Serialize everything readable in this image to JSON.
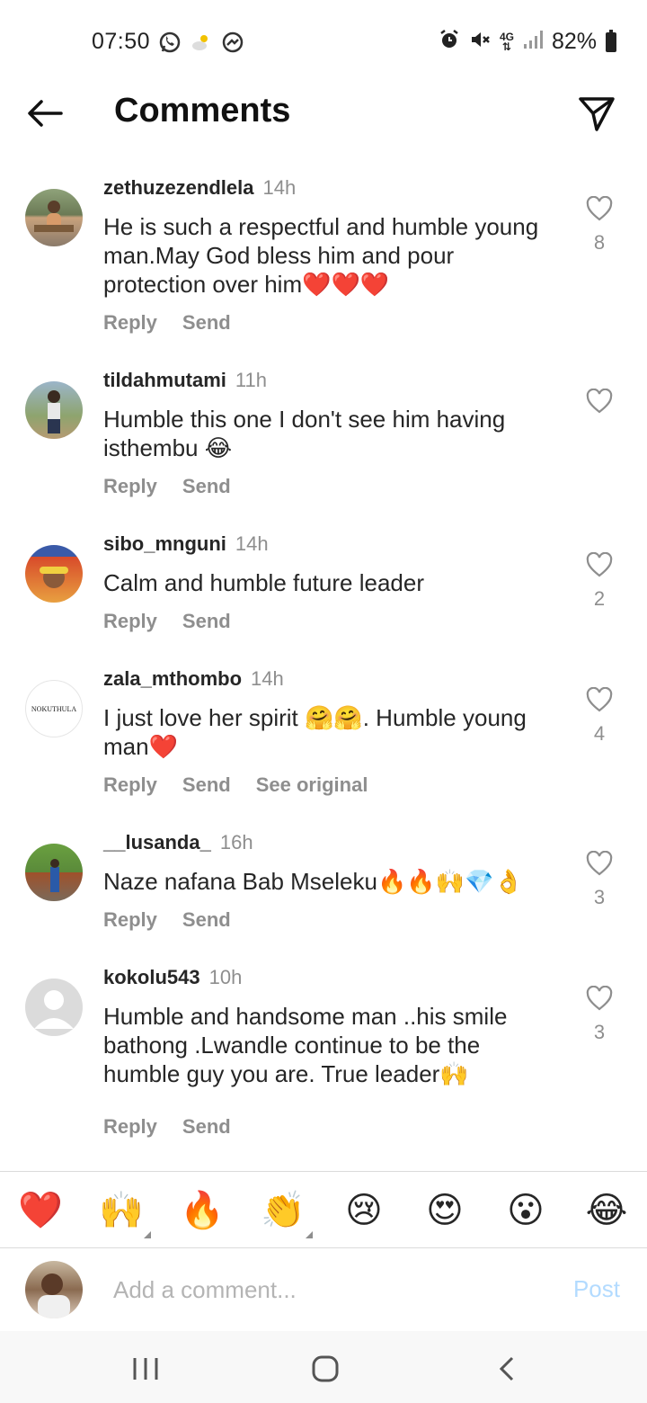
{
  "status_bar": {
    "time": "07:50",
    "battery": "82%",
    "network": "4G",
    "left_icons": [
      "whatsapp-icon",
      "weather-icon",
      "messenger-icon"
    ],
    "right_icons": [
      "alarm-icon",
      "mute-icon",
      "network-4g-icon",
      "signal-icon",
      "battery-icon"
    ]
  },
  "header": {
    "title": "Comments"
  },
  "comments": [
    {
      "username": "zethuzezendlela",
      "time": "14h",
      "text": "He is such a respectful and humble young man.May God bless him and pour protection over him❤️❤️❤️",
      "likes": "8",
      "actions": [
        "Reply",
        "Send"
      ]
    },
    {
      "username": "tildahmutami",
      "time": "11h",
      "text": "Humble this one I don't see him having isthembu 😂",
      "likes": "",
      "actions": [
        "Reply",
        "Send"
      ]
    },
    {
      "username": "sibo_mnguni",
      "time": "14h",
      "text": "Calm and humble future leader",
      "likes": "2",
      "actions": [
        "Reply",
        "Send"
      ]
    },
    {
      "username": "zala_mthombo",
      "time": "14h",
      "text": "I just love her spirit 🤗🤗. Humble young man❤️",
      "likes": "4",
      "actions": [
        "Reply",
        "Send",
        "See original"
      ],
      "avatar_text": "NOKUTHULA"
    },
    {
      "username": "__lusanda_",
      "time": "16h",
      "text": "Naze nafana Bab Mseleku🔥🔥🙌💎👌",
      "likes": "3",
      "actions": [
        "Reply",
        "Send"
      ]
    },
    {
      "username": "kokolu543",
      "time": "10h",
      "text": "Humble and handsome man ..his smile bathong .Lwandle continue to be the humble guy you are. True leader🙌",
      "likes": "3",
      "actions": [
        "Reply",
        "Send"
      ]
    }
  ],
  "reactions": [
    "❤️",
    "🙌",
    "🔥",
    "👏",
    "😢",
    "😍",
    "😮",
    "😂"
  ],
  "add_comment": {
    "placeholder": "Add a comment...",
    "post_label": "Post"
  },
  "nav_icons": [
    "recents-icon",
    "home-icon",
    "back-icon"
  ]
}
